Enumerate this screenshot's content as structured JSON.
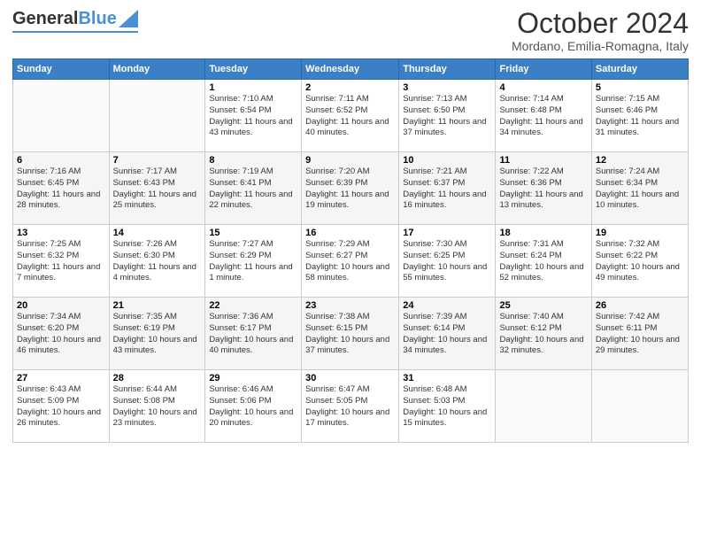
{
  "header": {
    "logo_general": "General",
    "logo_blue": "Blue",
    "month_title": "October 2024",
    "location": "Mordano, Emilia-Romagna, Italy"
  },
  "weekdays": [
    "Sunday",
    "Monday",
    "Tuesday",
    "Wednesday",
    "Thursday",
    "Friday",
    "Saturday"
  ],
  "weeks": [
    [
      {
        "day": "",
        "sunrise": "",
        "sunset": "",
        "daylight": ""
      },
      {
        "day": "",
        "sunrise": "",
        "sunset": "",
        "daylight": ""
      },
      {
        "day": "1",
        "sunrise": "Sunrise: 7:10 AM",
        "sunset": "Sunset: 6:54 PM",
        "daylight": "Daylight: 11 hours and 43 minutes."
      },
      {
        "day": "2",
        "sunrise": "Sunrise: 7:11 AM",
        "sunset": "Sunset: 6:52 PM",
        "daylight": "Daylight: 11 hours and 40 minutes."
      },
      {
        "day": "3",
        "sunrise": "Sunrise: 7:13 AM",
        "sunset": "Sunset: 6:50 PM",
        "daylight": "Daylight: 11 hours and 37 minutes."
      },
      {
        "day": "4",
        "sunrise": "Sunrise: 7:14 AM",
        "sunset": "Sunset: 6:48 PM",
        "daylight": "Daylight: 11 hours and 34 minutes."
      },
      {
        "day": "5",
        "sunrise": "Sunrise: 7:15 AM",
        "sunset": "Sunset: 6:46 PM",
        "daylight": "Daylight: 11 hours and 31 minutes."
      }
    ],
    [
      {
        "day": "6",
        "sunrise": "Sunrise: 7:16 AM",
        "sunset": "Sunset: 6:45 PM",
        "daylight": "Daylight: 11 hours and 28 minutes."
      },
      {
        "day": "7",
        "sunrise": "Sunrise: 7:17 AM",
        "sunset": "Sunset: 6:43 PM",
        "daylight": "Daylight: 11 hours and 25 minutes."
      },
      {
        "day": "8",
        "sunrise": "Sunrise: 7:19 AM",
        "sunset": "Sunset: 6:41 PM",
        "daylight": "Daylight: 11 hours and 22 minutes."
      },
      {
        "day": "9",
        "sunrise": "Sunrise: 7:20 AM",
        "sunset": "Sunset: 6:39 PM",
        "daylight": "Daylight: 11 hours and 19 minutes."
      },
      {
        "day": "10",
        "sunrise": "Sunrise: 7:21 AM",
        "sunset": "Sunset: 6:37 PM",
        "daylight": "Daylight: 11 hours and 16 minutes."
      },
      {
        "day": "11",
        "sunrise": "Sunrise: 7:22 AM",
        "sunset": "Sunset: 6:36 PM",
        "daylight": "Daylight: 11 hours and 13 minutes."
      },
      {
        "day": "12",
        "sunrise": "Sunrise: 7:24 AM",
        "sunset": "Sunset: 6:34 PM",
        "daylight": "Daylight: 11 hours and 10 minutes."
      }
    ],
    [
      {
        "day": "13",
        "sunrise": "Sunrise: 7:25 AM",
        "sunset": "Sunset: 6:32 PM",
        "daylight": "Daylight: 11 hours and 7 minutes."
      },
      {
        "day": "14",
        "sunrise": "Sunrise: 7:26 AM",
        "sunset": "Sunset: 6:30 PM",
        "daylight": "Daylight: 11 hours and 4 minutes."
      },
      {
        "day": "15",
        "sunrise": "Sunrise: 7:27 AM",
        "sunset": "Sunset: 6:29 PM",
        "daylight": "Daylight: 11 hours and 1 minute."
      },
      {
        "day": "16",
        "sunrise": "Sunrise: 7:29 AM",
        "sunset": "Sunset: 6:27 PM",
        "daylight": "Daylight: 10 hours and 58 minutes."
      },
      {
        "day": "17",
        "sunrise": "Sunrise: 7:30 AM",
        "sunset": "Sunset: 6:25 PM",
        "daylight": "Daylight: 10 hours and 55 minutes."
      },
      {
        "day": "18",
        "sunrise": "Sunrise: 7:31 AM",
        "sunset": "Sunset: 6:24 PM",
        "daylight": "Daylight: 10 hours and 52 minutes."
      },
      {
        "day": "19",
        "sunrise": "Sunrise: 7:32 AM",
        "sunset": "Sunset: 6:22 PM",
        "daylight": "Daylight: 10 hours and 49 minutes."
      }
    ],
    [
      {
        "day": "20",
        "sunrise": "Sunrise: 7:34 AM",
        "sunset": "Sunset: 6:20 PM",
        "daylight": "Daylight: 10 hours and 46 minutes."
      },
      {
        "day": "21",
        "sunrise": "Sunrise: 7:35 AM",
        "sunset": "Sunset: 6:19 PM",
        "daylight": "Daylight: 10 hours and 43 minutes."
      },
      {
        "day": "22",
        "sunrise": "Sunrise: 7:36 AM",
        "sunset": "Sunset: 6:17 PM",
        "daylight": "Daylight: 10 hours and 40 minutes."
      },
      {
        "day": "23",
        "sunrise": "Sunrise: 7:38 AM",
        "sunset": "Sunset: 6:15 PM",
        "daylight": "Daylight: 10 hours and 37 minutes."
      },
      {
        "day": "24",
        "sunrise": "Sunrise: 7:39 AM",
        "sunset": "Sunset: 6:14 PM",
        "daylight": "Daylight: 10 hours and 34 minutes."
      },
      {
        "day": "25",
        "sunrise": "Sunrise: 7:40 AM",
        "sunset": "Sunset: 6:12 PM",
        "daylight": "Daylight: 10 hours and 32 minutes."
      },
      {
        "day": "26",
        "sunrise": "Sunrise: 7:42 AM",
        "sunset": "Sunset: 6:11 PM",
        "daylight": "Daylight: 10 hours and 29 minutes."
      }
    ],
    [
      {
        "day": "27",
        "sunrise": "Sunrise: 6:43 AM",
        "sunset": "Sunset: 5:09 PM",
        "daylight": "Daylight: 10 hours and 26 minutes."
      },
      {
        "day": "28",
        "sunrise": "Sunrise: 6:44 AM",
        "sunset": "Sunset: 5:08 PM",
        "daylight": "Daylight: 10 hours and 23 minutes."
      },
      {
        "day": "29",
        "sunrise": "Sunrise: 6:46 AM",
        "sunset": "Sunset: 5:06 PM",
        "daylight": "Daylight: 10 hours and 20 minutes."
      },
      {
        "day": "30",
        "sunrise": "Sunrise: 6:47 AM",
        "sunset": "Sunset: 5:05 PM",
        "daylight": "Daylight: 10 hours and 17 minutes."
      },
      {
        "day": "31",
        "sunrise": "Sunrise: 6:48 AM",
        "sunset": "Sunset: 5:03 PM",
        "daylight": "Daylight: 10 hours and 15 minutes."
      },
      {
        "day": "",
        "sunrise": "",
        "sunset": "",
        "daylight": ""
      },
      {
        "day": "",
        "sunrise": "",
        "sunset": "",
        "daylight": ""
      }
    ]
  ]
}
